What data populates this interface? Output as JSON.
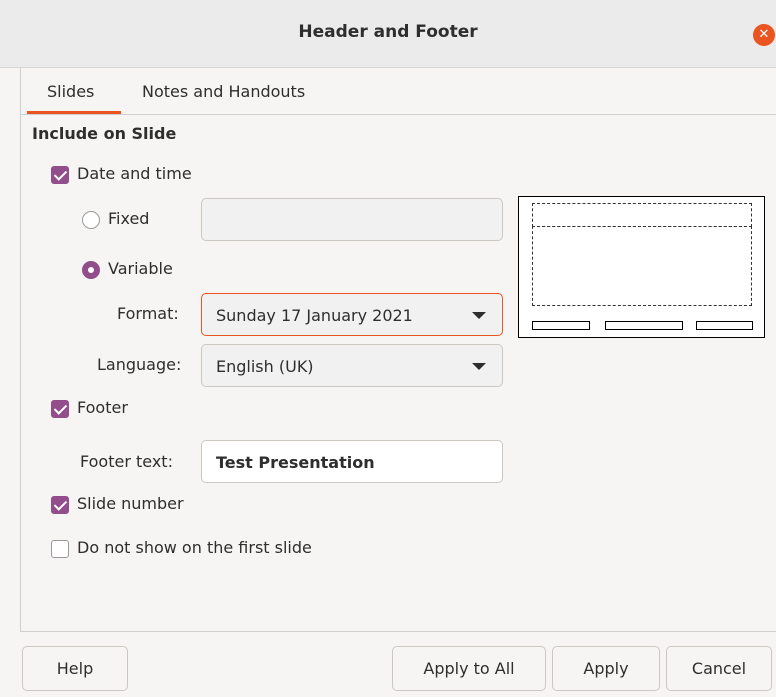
{
  "window": {
    "title": "Header and Footer"
  },
  "tabs": [
    {
      "label": "Slides",
      "active": true
    },
    {
      "label": "Notes and Handouts",
      "active": false
    }
  ],
  "section": {
    "title": "Include on Slide"
  },
  "date_time": {
    "label": "Date and time",
    "checked": true,
    "fixed": {
      "label": "Fixed",
      "selected": false,
      "value": ""
    },
    "variable": {
      "label": "Variable",
      "selected": true
    },
    "format": {
      "label": "Format:",
      "value": "Sunday 17 January 2021"
    },
    "language": {
      "label": "Language:",
      "value": "English (UK)"
    }
  },
  "footer": {
    "label": "Footer",
    "checked": true,
    "text_label": "Footer text:",
    "text_value": "Test Presentation"
  },
  "slide_number": {
    "label": "Slide number",
    "checked": true
  },
  "first_slide": {
    "label": "Do not show on the first slide",
    "checked": false
  },
  "buttons": {
    "help": "Help",
    "apply_all": "Apply to All",
    "apply": "Apply",
    "cancel": "Cancel"
  },
  "colors": {
    "accent": "#e95420",
    "check": "#924d8b"
  }
}
